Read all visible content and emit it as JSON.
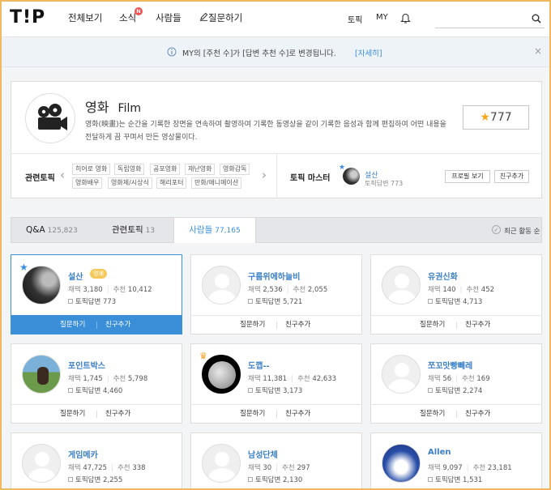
{
  "header": {
    "logo": "T!P",
    "nav": [
      "전체보기",
      "소식",
      "사람들",
      "질문하기"
    ],
    "news_badge": "N",
    "right_nav": [
      "토픽",
      "MY"
    ],
    "icons": [
      "bell-icon",
      "search-icon",
      "pencil-icon"
    ]
  },
  "notice": {
    "text": "MY의 [주천 수]가 [답변 추천 수]로 변경됩니다.",
    "link": "[자세히]",
    "close": "×"
  },
  "topic": {
    "title_ko": "영화",
    "title_en": "Film",
    "description": "영화(映畫)는 순간을 기록한 장면을 연속하여 촬영하여 기록한 동영상을 같이 기록한 음성과 함께 편집하여 어떤 내용을 전달하게 끔 꾸며서 만든 영상물이다.",
    "star_count": "777",
    "related_label": "관련토픽",
    "related_tags": [
      "히어로 영화",
      "독립영화",
      "공포영화",
      "재난영화",
      "영화감독",
      "영화배우",
      "영화제/시상식",
      "해리포터",
      "만화/애니메이션"
    ],
    "master_label": "토픽 마스터",
    "master": {
      "name": "설산",
      "answers_label": "토픽답변",
      "answers": "773"
    },
    "profile_button": "프로필 보기",
    "add_friend_button": "친구추가"
  },
  "tabs": [
    {
      "label": "Q&A",
      "count": "125,823"
    },
    {
      "label": "관련토픽",
      "count": "13"
    },
    {
      "label": "사람들",
      "count": "77,165"
    }
  ],
  "recent_sort": "최근 활동 순",
  "user_labels": {
    "adopt": "채택",
    "recommend": "추천",
    "topic_answers": "토픽답변",
    "ask": "질문하기",
    "add_friend": "친구추가",
    "honor": "명예"
  },
  "users": [
    {
      "name": "설산",
      "adopt": "3,180",
      "recommend": "10,412",
      "answers": "773"
    },
    {
      "name": "구름위에하늘비",
      "adopt": "2,536",
      "recommend": "2,055",
      "answers": "5,721"
    },
    {
      "name": "유권신화",
      "adopt": "140",
      "recommend": "452",
      "answers": "4,713"
    },
    {
      "name": "포인트박스",
      "adopt": "1,745",
      "recommend": "5,798",
      "answers": "4,460"
    },
    {
      "name": "도깹--",
      "adopt": "11,381",
      "recommend": "42,633",
      "answers": "3,173"
    },
    {
      "name": "쪼꼬맛빵빼레",
      "adopt": "56",
      "recommend": "169",
      "answers": "2,274"
    },
    {
      "name": "게임메카",
      "adopt": "47,725",
      "recommend": "338",
      "answers": "2,255"
    },
    {
      "name": "남성단체",
      "adopt": "30",
      "recommend": "297",
      "answers": "2,130"
    },
    {
      "name": "Allen",
      "adopt": "9,097",
      "recommend": "23,181",
      "answers": "1,531"
    }
  ]
}
